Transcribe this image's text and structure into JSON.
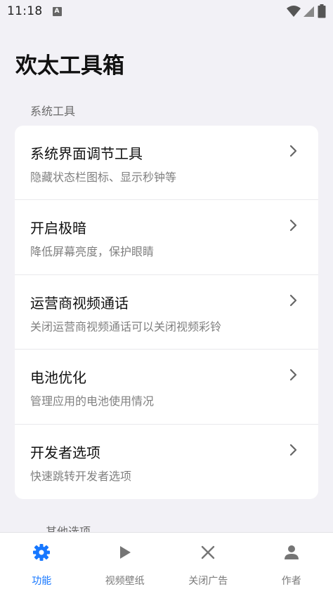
{
  "status_bar": {
    "time": "11:18",
    "notification_icon": "A"
  },
  "app": {
    "title": "欢太工具箱"
  },
  "sections": [
    {
      "label": "系统工具"
    },
    {
      "label": "其他选项"
    }
  ],
  "items": [
    {
      "title": "系统界面调节工具",
      "subtitle": "隐藏状态栏图标、显示秒钟等"
    },
    {
      "title": "开启极暗",
      "subtitle": "降低屏幕亮度，保护眼睛"
    },
    {
      "title": "运营商视频通话",
      "subtitle": "关闭运营商视频通话可以关闭视频彩铃"
    },
    {
      "title": "电池优化",
      "subtitle": "管理应用的电池使用情况"
    },
    {
      "title": "开发者选项",
      "subtitle": "快速跳转开发者选项"
    }
  ],
  "bottom_nav": [
    {
      "label": "功能",
      "icon": "gear-icon",
      "active": true
    },
    {
      "label": "视频壁纸",
      "icon": "play-icon",
      "active": false
    },
    {
      "label": "关闭广告",
      "icon": "close-icon",
      "active": false
    },
    {
      "label": "作者",
      "icon": "person-icon",
      "active": false
    }
  ],
  "colors": {
    "accent": "#1677ff",
    "background": "#f2f1f6"
  }
}
